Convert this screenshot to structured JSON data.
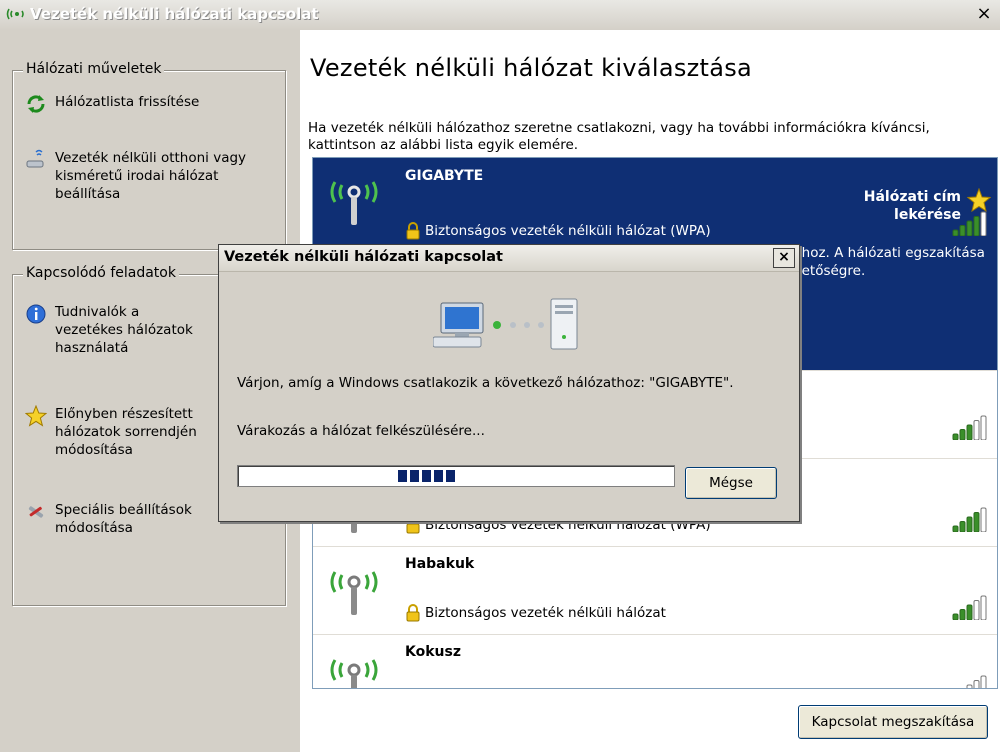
{
  "window": {
    "title": "Vezeték nélküli hálózati kapcsolat",
    "close": "×"
  },
  "left": {
    "group1": {
      "title": "Hálózati műveletek",
      "items": [
        {
          "label": "Hálózatlista frissítése",
          "icon": "refresh-icon"
        },
        {
          "label": "Vezeték nélküli otthoni vagy kisméretű irodai hálózat beállítása",
          "icon": "wireless-setup-icon"
        }
      ]
    },
    "group2": {
      "title": "Kapcsolódó feladatok",
      "items": [
        {
          "label": "Tudnivalók a vezetékes hálózatok használatá",
          "icon": "info-icon"
        },
        {
          "label": "Előnyben részesített hálózatok sorrendjén módosítása",
          "icon": "star-icon"
        },
        {
          "label": "Speciális beállítások módosítása",
          "icon": "tools-icon"
        }
      ]
    }
  },
  "main": {
    "title": "Vezeték nélküli hálózat kiválasztása",
    "intro": "Ha vezeték nélküli hálózathoz szeretne csatlakozni, vagy ha további információkra kíváncsi, kattintson az alábbi lista egyik elemére.",
    "selected": {
      "name": "GIGABYTE",
      "security": "Biztonságos vezeték nélküli hálózat (WPA)",
      "status": "Hálózati cím lekérése",
      "desc": "zathoz. A hálózati egszakítása lehetőségre.",
      "signal": 4
    },
    "networks": [
      {
        "name": "",
        "security": "",
        "signal": 3
      },
      {
        "name": "",
        "security": "Biztonságos vezeték nélküli hálózat (WPA)",
        "signal": 4
      },
      {
        "name": "Habakuk",
        "security": "Biztonságos vezeték nélküli hálózat",
        "signal": 3
      },
      {
        "name": "Kokusz",
        "security": "",
        "signal": 1
      }
    ],
    "disconnect_label": "Kapcsolat megszakítása"
  },
  "dialog": {
    "title": "Vezeték nélküli hálózati kapcsolat",
    "close": "×",
    "message": "Várjon, amíg a Windows csatlakozik a következő hálózathoz: \"GIGABYTE\".",
    "status": "Várakozás a hálózat felkészülésére...",
    "progress_blocks": 5,
    "cancel_label": "Mégse"
  },
  "colors": {
    "selection": "#0f2f74",
    "signal": "#3a8f2a",
    "progress": "#0a246a"
  }
}
